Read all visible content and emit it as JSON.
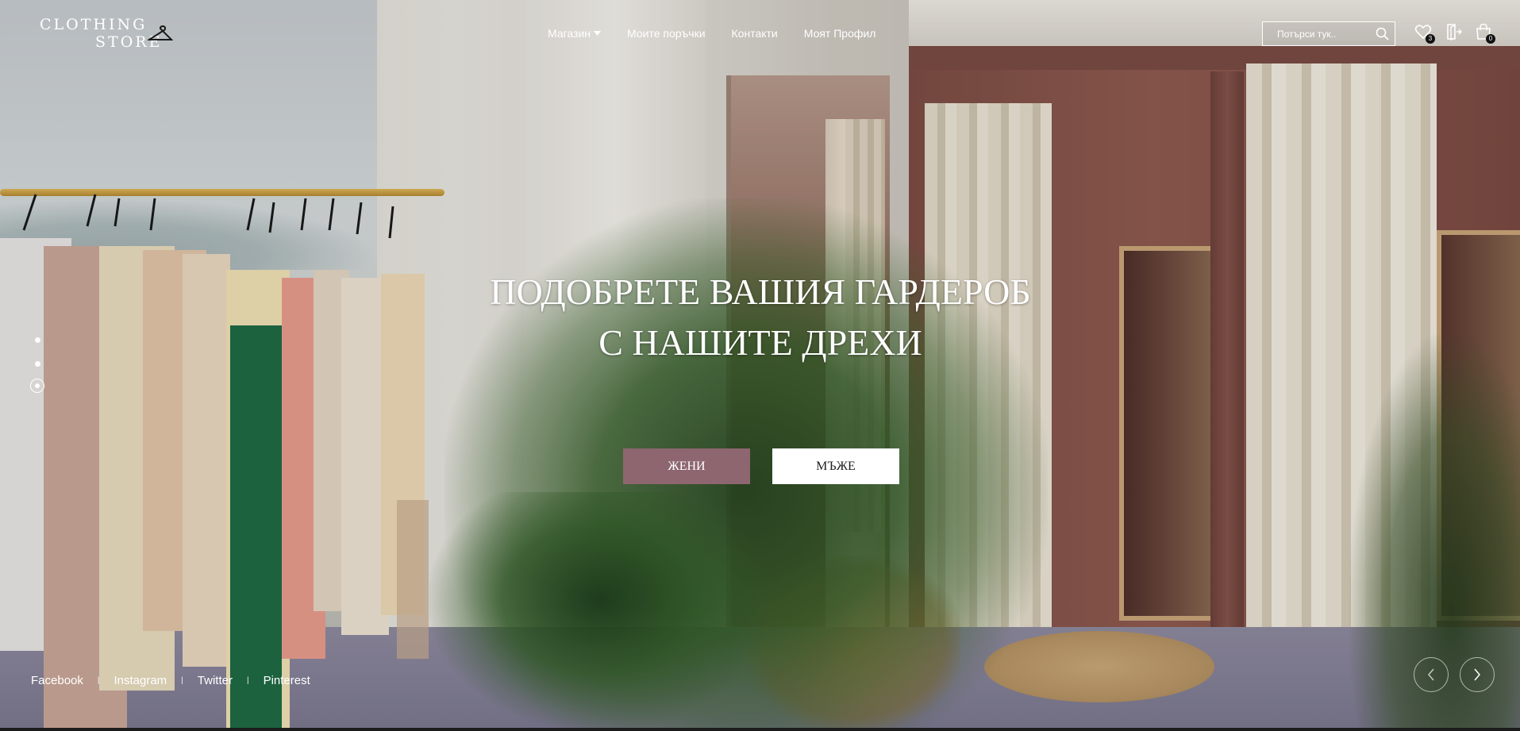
{
  "brand": {
    "logo_line1": "CLOTHING",
    "logo_line2": "STORE"
  },
  "nav": {
    "shop": "Магазин",
    "orders": "Моите поръчки",
    "contacts": "Контакти",
    "profile": "Моят Профил"
  },
  "search": {
    "placeholder": "Потърси тук.."
  },
  "header_icons": {
    "wishlist_icon": "heart-icon",
    "wishlist_count": "3",
    "logout_icon": "door-exit-icon",
    "cart_icon": "shopping-bag-icon",
    "cart_count": "0"
  },
  "hero": {
    "title_line1": "ПОДОБРЕТЕ ВАШИЯ ГАРДЕРОБ",
    "title_line2": "С НАШИТЕ ДРЕХИ",
    "button_women": "ЖЕНИ",
    "button_men": "МЪЖЕ"
  },
  "slider": {
    "slides_total": 3,
    "active_slide": 3
  },
  "social": [
    "Facebook",
    "Instagram",
    "Twitter",
    "Pinterest"
  ],
  "colors": {
    "accent": "#8d6670",
    "text": "#ffffff"
  }
}
